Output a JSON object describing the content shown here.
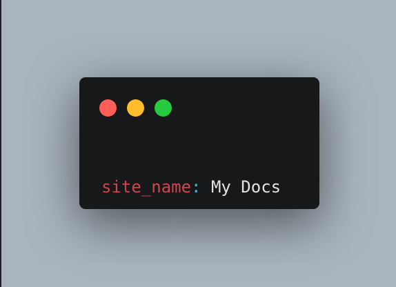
{
  "window": {
    "controls": [
      {
        "name": "close",
        "icon": "close-dot-icon",
        "color": "#ff5f56"
      },
      {
        "name": "minimize",
        "icon": "minimize-dot-icon",
        "color": "#ffbd2e"
      },
      {
        "name": "maximize",
        "icon": "maximize-dot-icon",
        "color": "#27c93f"
      }
    ],
    "background": "#17181a"
  },
  "code": {
    "key": "site_name",
    "separator": ":",
    "value": " My Docs",
    "colors": {
      "key": "#d1464b",
      "separator": "#47b8d6",
      "value": "#e1e3e6"
    }
  },
  "page": {
    "background": "#a9b4be"
  }
}
